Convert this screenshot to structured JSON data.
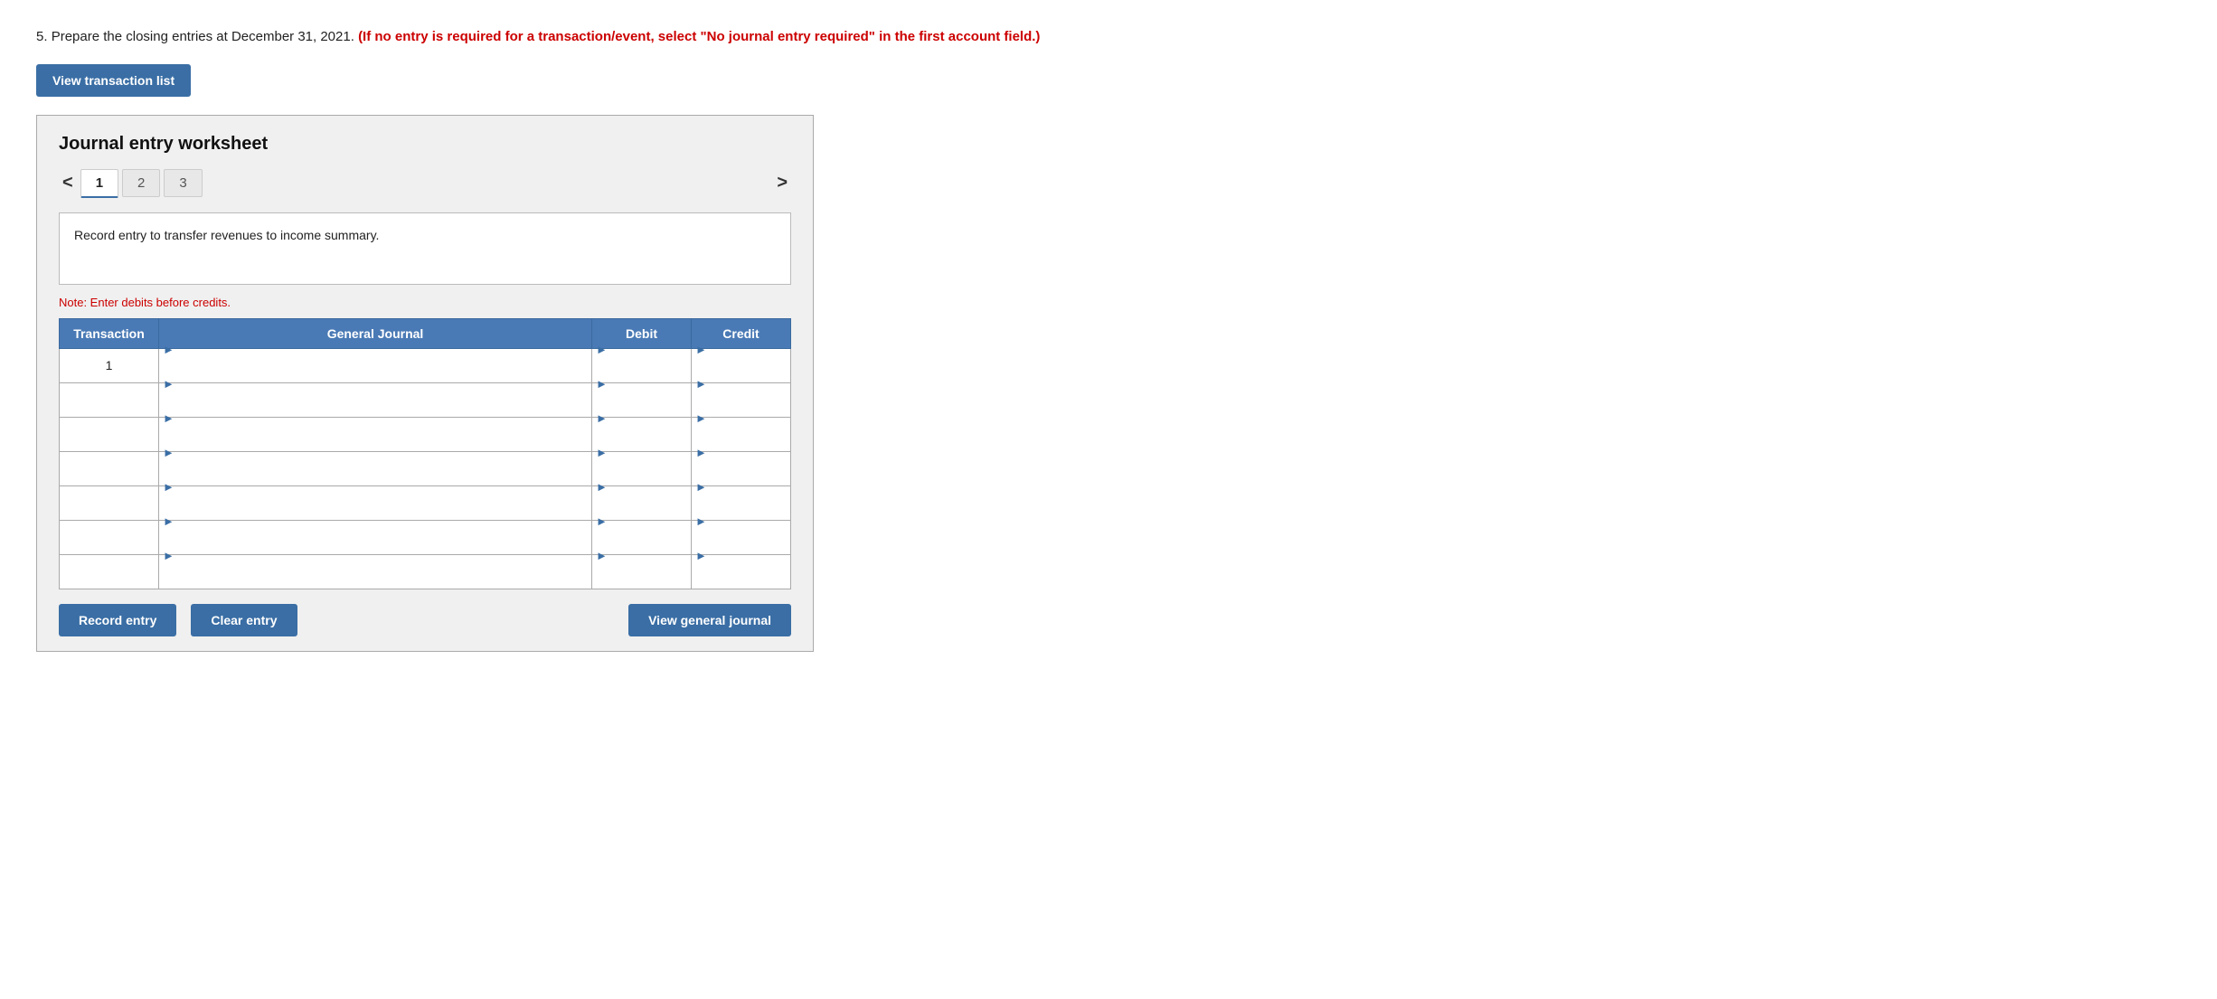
{
  "question": {
    "number": "5.",
    "text_normal": "Prepare the closing entries at December 31, 2021.",
    "text_highlight": "(If no entry is required for a transaction/event, select \"No journal entry required\" in the first account field.)"
  },
  "view_transaction_btn": "View transaction list",
  "worksheet": {
    "title": "Journal entry worksheet",
    "tabs": [
      {
        "label": "1",
        "active": true
      },
      {
        "label": "2",
        "active": false
      },
      {
        "label": "3",
        "active": false
      }
    ],
    "prev_arrow": "<",
    "next_arrow": ">",
    "description": "Record entry to transfer revenues to income summary.",
    "note": "Note: Enter debits before credits.",
    "table": {
      "headers": {
        "transaction": "Transaction",
        "general_journal": "General Journal",
        "debit": "Debit",
        "credit": "Credit"
      },
      "rows": [
        {
          "transaction": "1",
          "general_journal": "",
          "debit": "",
          "credit": ""
        },
        {
          "transaction": "",
          "general_journal": "",
          "debit": "",
          "credit": ""
        },
        {
          "transaction": "",
          "general_journal": "",
          "debit": "",
          "credit": ""
        },
        {
          "transaction": "",
          "general_journal": "",
          "debit": "",
          "credit": ""
        },
        {
          "transaction": "",
          "general_journal": "",
          "debit": "",
          "credit": ""
        },
        {
          "transaction": "",
          "general_journal": "",
          "debit": "",
          "credit": ""
        },
        {
          "transaction": "",
          "general_journal": "",
          "debit": "",
          "credit": ""
        }
      ]
    }
  },
  "buttons": {
    "record_entry": "Record entry",
    "clear_entry": "Clear entry",
    "view_general_journal": "View general journal"
  }
}
